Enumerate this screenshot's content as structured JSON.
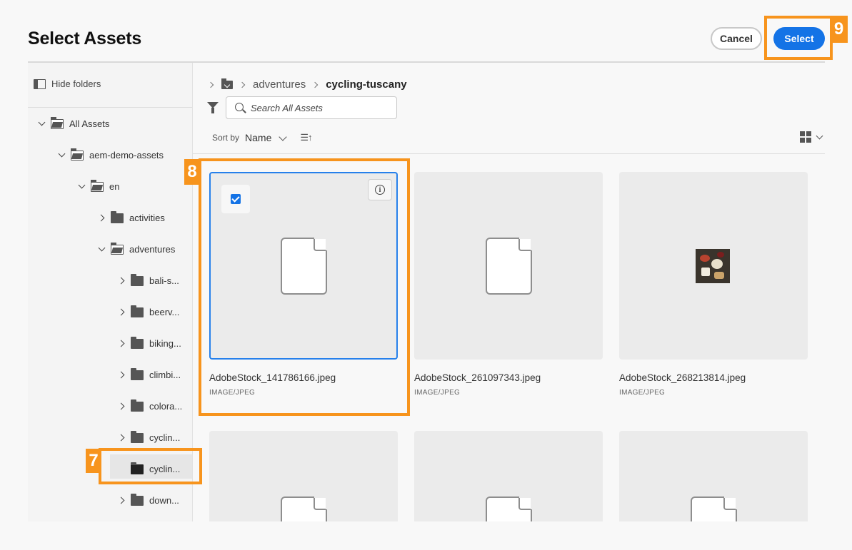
{
  "dialog": {
    "title": "Select Assets",
    "cancel_label": "Cancel",
    "select_label": "Select"
  },
  "callouts": [
    "7",
    "8",
    "9"
  ],
  "sidebar": {
    "hide_folders_label": "Hide folders",
    "tree": [
      {
        "label": "All Assets",
        "state": "expanded",
        "level": 0
      },
      {
        "label": "aem-demo-assets",
        "state": "expanded",
        "level": 1
      },
      {
        "label": "en",
        "state": "expanded",
        "level": 2
      },
      {
        "label": "activities",
        "state": "collapsed",
        "level": 3
      },
      {
        "label": "adventures",
        "state": "expanded",
        "level": 3
      },
      {
        "label": "bali-s...",
        "state": "collapsed",
        "level": 4
      },
      {
        "label": "beerv...",
        "state": "collapsed",
        "level": 4
      },
      {
        "label": "biking...",
        "state": "collapsed",
        "level": 4
      },
      {
        "label": "climbi...",
        "state": "collapsed",
        "level": 4
      },
      {
        "label": "colora...",
        "state": "collapsed",
        "level": 4
      },
      {
        "label": "cyclin...",
        "state": "collapsed",
        "level": 4
      },
      {
        "label": "cyclin...",
        "state": "selected",
        "level": 4
      },
      {
        "label": "down...",
        "state": "collapsed",
        "level": 4
      }
    ]
  },
  "breadcrumb": {
    "items": [
      "adventures"
    ],
    "current": "cycling-tuscany"
  },
  "search": {
    "placeholder": "Search All Assets",
    "value": ""
  },
  "sort": {
    "label": "Sort by",
    "value": "Name",
    "direction_icon": "sort-ascending-icon"
  },
  "view": {
    "mode_icon": "grid-view-icon"
  },
  "assets": [
    {
      "name": "AdobeStock_141786166.jpeg",
      "type": "IMAGE/JPEG",
      "selected": true,
      "thumb": "file-icon"
    },
    {
      "name": "AdobeStock_261097343.jpeg",
      "type": "IMAGE/JPEG",
      "selected": false,
      "thumb": "file-icon"
    },
    {
      "name": "AdobeStock_268213814.jpeg",
      "type": "IMAGE/JPEG",
      "selected": false,
      "thumb": "photo"
    },
    {
      "name": "",
      "type": "",
      "selected": false,
      "thumb": "file-icon"
    },
    {
      "name": "",
      "type": "",
      "selected": false,
      "thumb": "file-icon"
    },
    {
      "name": "",
      "type": "",
      "selected": false,
      "thumb": "file-icon"
    }
  ],
  "colors": {
    "accent": "#1473e6",
    "callout": "#f7941d",
    "selection_border": "#2680eb"
  }
}
